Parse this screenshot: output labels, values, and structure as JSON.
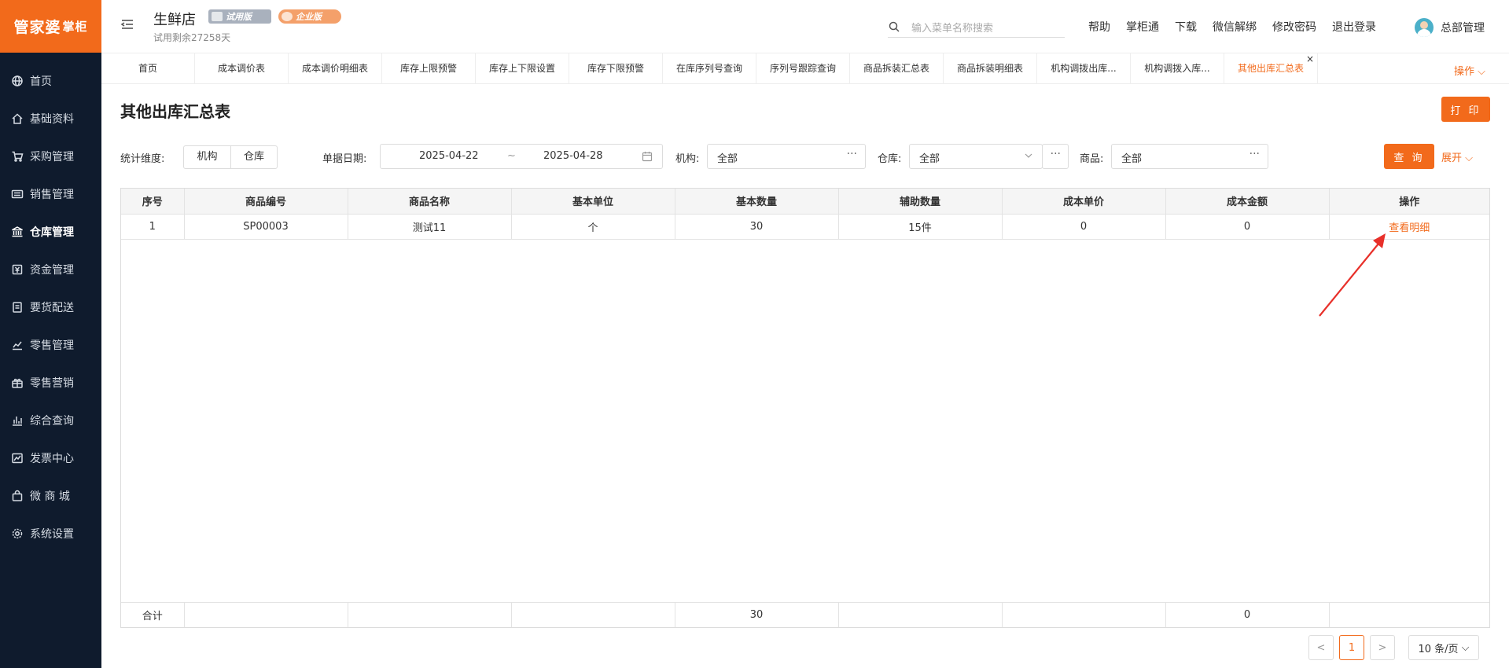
{
  "brand": {
    "logo_main": "管家婆",
    "logo_sub": "掌柜",
    "accent_color": "#f26a1b",
    "sidebar_color": "#0f1b2d"
  },
  "sidebar": {
    "items": [
      {
        "label": "首页",
        "icon": "globe-icon"
      },
      {
        "label": "基础资料",
        "icon": "home-icon"
      },
      {
        "label": "采购管理",
        "icon": "cart-icon"
      },
      {
        "label": "销售管理",
        "icon": "keyboard-icon"
      },
      {
        "label": "仓库管理",
        "icon": "bank-icon",
        "active": true
      },
      {
        "label": "资金管理",
        "icon": "yen-icon"
      },
      {
        "label": "要货配送",
        "icon": "doc-icon"
      },
      {
        "label": "零售管理",
        "icon": "chart-icon"
      },
      {
        "label": "零售营销",
        "icon": "gift-icon"
      },
      {
        "label": "综合查询",
        "icon": "bars-icon"
      },
      {
        "label": "发票中心",
        "icon": "trend-icon"
      },
      {
        "label": "微 商 城",
        "icon": "bag-icon"
      },
      {
        "label": "系统设置",
        "icon": "gear-icon"
      }
    ]
  },
  "header": {
    "shop_name": "生鲜店",
    "badge_trial": "试用版",
    "badge_enterprise": "企业版",
    "trial_left": "试用剩余27258天",
    "search_placeholder": "输入菜单名称搜索",
    "links": [
      "帮助",
      "掌柜通",
      "下载",
      "微信解绑",
      "修改密码",
      "退出登录"
    ],
    "user_name": "总部管理"
  },
  "tabs": [
    {
      "label": "首页",
      "w": 119
    },
    {
      "label": "成本调价表",
      "w": 119
    },
    {
      "label": "成本调价明细表",
      "w": 119
    },
    {
      "label": "库存上限预警",
      "w": 119
    },
    {
      "label": "库存上下限设置",
      "w": 119
    },
    {
      "label": "库存下限预警",
      "w": 119
    },
    {
      "label": "在库序列号查询",
      "w": 119
    },
    {
      "label": "序列号跟踪查询",
      "w": 119
    },
    {
      "label": "商品拆装汇总表",
      "w": 119
    },
    {
      "label": "商品拆装明细表",
      "w": 119
    },
    {
      "label": "机构调拨出库...",
      "w": 119
    },
    {
      "label": "机构调拨入库...",
      "w": 119
    },
    {
      "label": "其他出库汇总表",
      "w": 119,
      "active": true
    }
  ],
  "tab_ops": "操作",
  "page": {
    "title": "其他出库汇总表",
    "print": "打 印",
    "filters": {
      "dim_label": "统计维度:",
      "dim_options": [
        "机构",
        "仓库"
      ],
      "date_label": "单据日期:",
      "date_from": "2025-04-22",
      "date_sep": "~",
      "date_to": "2025-04-28",
      "org_label": "机构:",
      "org_value": "全部",
      "wh_label": "仓库:",
      "wh_value": "全部",
      "prod_label": "商品:",
      "prod_value": "全部",
      "query": "查 询",
      "expand": "展开"
    }
  },
  "table": {
    "columns": [
      "序号",
      "商品编号",
      "商品名称",
      "基本单位",
      "基本数量",
      "辅助数量",
      "成本单价",
      "成本金额",
      "操作"
    ],
    "rows": [
      [
        "1",
        "SP00003",
        "测试11",
        "个",
        "30",
        "15件",
        "0",
        "0",
        "查看明细"
      ]
    ],
    "summary": [
      "合计",
      "",
      "",
      "",
      "30",
      "",
      "",
      "0",
      ""
    ]
  },
  "pagination": {
    "prev": "<",
    "current": "1",
    "next": ">",
    "page_size": "10 条/页"
  }
}
